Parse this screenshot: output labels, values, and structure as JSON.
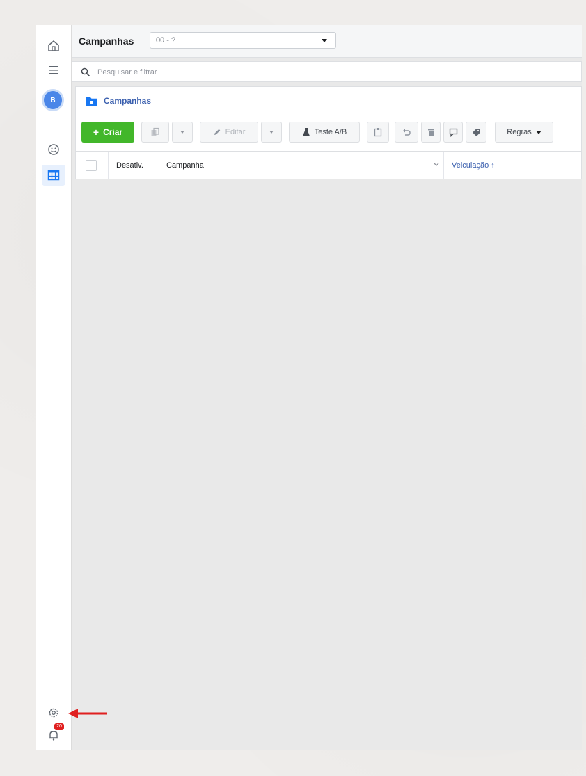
{
  "header": {
    "title": "Campanhas",
    "account_value": "00 - ?"
  },
  "search": {
    "placeholder": "Pesquisar e filtrar"
  },
  "breadcrumb": {
    "label": "Campanhas"
  },
  "toolbar": {
    "create_label": "Criar",
    "edit_label": "Editar",
    "ab_test_label": "Teste A/B",
    "rules_label": "Regras"
  },
  "table": {
    "columns": {
      "off_on": "Desativ.",
      "campaign": "Campanha",
      "delivery": "Veiculação ↑"
    }
  },
  "rail": {
    "avatar_initial": "B",
    "notification_count": "20"
  },
  "colors": {
    "create_button": "#42b72a",
    "accent": "#3a5fae",
    "annotation_arrow": "#e02020"
  }
}
